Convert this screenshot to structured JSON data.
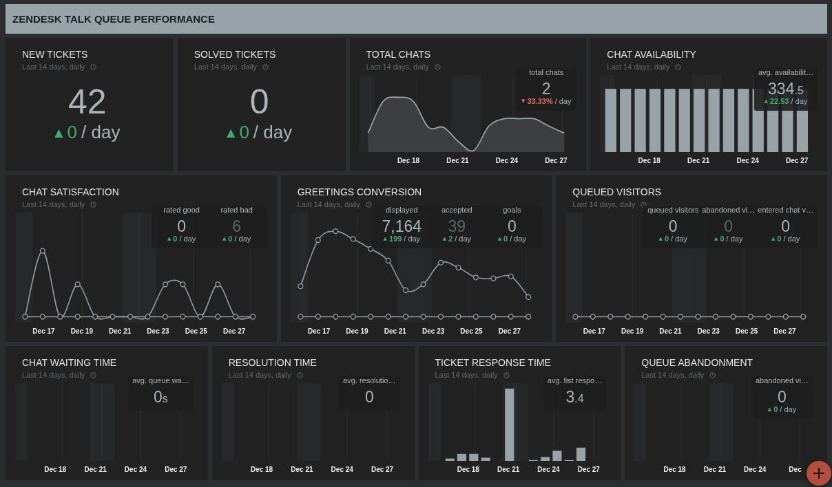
{
  "header": {
    "title": "ZENDESK TALK QUEUE PERFORMANCE"
  },
  "rows": [
    {
      "cards": [
        {
          "title": "NEW TICKETS",
          "subtitle": "Last 14 days, daily",
          "kind": "number",
          "value": "42",
          "rising": true,
          "arrow": "▲",
          "delta": "0",
          "per": "/ day"
        },
        {
          "title": "SOLVED TICKETS",
          "subtitle": "Last 14 days, daily",
          "kind": "number",
          "value": "0",
          "rising": true,
          "arrow": "▲",
          "delta": "0",
          "per": "/ day"
        },
        {
          "title": "TOTAL CHATS",
          "subtitle": "Last 14 days, daily",
          "kind": "area",
          "x_labels": [
            "Dec 18",
            "Dec 21",
            "Dec 24",
            "Dec 27"
          ],
          "stats": [
            {
              "label": "total chats",
              "value": "2",
              "muted": false,
              "rising": false,
              "arrow": "▼",
              "delta": "33.33%",
              "per": "/ day"
            }
          ]
        },
        {
          "title": "CHAT AVAILABILITY",
          "subtitle": "Last 14 days, daily",
          "kind": "bars",
          "x_labels": [
            "Dec 18",
            "Dec 21",
            "Dec 24",
            "Dec 27"
          ],
          "stats": [
            {
              "label": "avg. availabilit…",
              "value": "334",
              "suffix": ".5",
              "muted": false,
              "rising": true,
              "arrow": "▲",
              "delta": "22.53",
              "per": "/ day"
            }
          ]
        }
      ]
    },
    {
      "cards": [
        {
          "title": "CHAT SATISFACTION",
          "subtitle": "Last 14 days, daily",
          "kind": "line",
          "x_labels": [
            "Dec 17",
            "Dec 19",
            "Dec 21",
            "Dec 23",
            "Dec 25",
            "Dec 27"
          ],
          "stats": [
            {
              "label": "rated good",
              "value": "0",
              "muted": false,
              "rising": true,
              "arrow": "▲",
              "delta": "0",
              "per": "/ day"
            },
            {
              "label": "rated bad",
              "value": "6",
              "muted": true,
              "rising": true,
              "arrow": "▲",
              "delta": "0",
              "per": "/ day"
            }
          ]
        },
        {
          "title": "GREETINGS CONVERSION",
          "subtitle": "Last 14 days, daily",
          "kind": "line",
          "x_labels": [
            "Dec 17",
            "Dec 19",
            "Dec 21",
            "Dec 23",
            "Dec 25",
            "Dec 27"
          ],
          "stats": [
            {
              "label": "displayed",
              "value": "7,164",
              "muted": false,
              "rising": true,
              "arrow": "▲",
              "delta": "199",
              "per": "/ day"
            },
            {
              "label": "accepted",
              "value": "39",
              "muted": true,
              "rising": true,
              "arrow": "▲",
              "delta": "2",
              "per": "/ day"
            },
            {
              "label": "goals",
              "value": "0",
              "muted": false,
              "rising": true,
              "arrow": "▲",
              "delta": "0",
              "per": "/ day"
            }
          ]
        },
        {
          "title": "QUEUED VISITORS",
          "subtitle": "Last 14 days, daily",
          "kind": "line",
          "x_labels": [
            "Dec 17",
            "Dec 19",
            "Dec 21",
            "Dec 23",
            "Dec 25",
            "Dec 27"
          ],
          "stats": [
            {
              "label": "queued visitors",
              "value": "0",
              "muted": false,
              "rising": true,
              "arrow": "▲",
              "delta": "0",
              "per": "/ day"
            },
            {
              "label": "abandoned vi…",
              "value": "0",
              "muted": true,
              "rising": true,
              "arrow": "▲",
              "delta": "0",
              "per": "/ day"
            },
            {
              "label": "entered chat v…",
              "value": "0",
              "muted": false,
              "rising": true,
              "arrow": "▲",
              "delta": "0",
              "per": "/ day"
            }
          ]
        }
      ]
    },
    {
      "cards": [
        {
          "title": "CHAT WAITING TIME",
          "subtitle": "Last 14 days, daily",
          "kind": "empty",
          "x_labels": [
            "Dec 18",
            "Dec 21",
            "Dec 24",
            "Dec 27"
          ],
          "stats": [
            {
              "label": "avg. queue wa…",
              "value": "0",
              "suffix": "s",
              "muted": false
            }
          ]
        },
        {
          "title": "RESOLUTION TIME",
          "subtitle": "Last 14 days, daily",
          "kind": "empty",
          "x_labels": [
            "Dec 18",
            "Dec 21",
            "Dec 24",
            "Dec 27"
          ],
          "stats": [
            {
              "label": "avg. resolutio…",
              "value": "0",
              "muted": false
            }
          ]
        },
        {
          "title": "TICKET RESPONSE TIME",
          "subtitle": "Last 14 days, daily",
          "kind": "bars",
          "x_labels": [
            "Dec 18",
            "Dec 21",
            "Dec 24",
            "Dec 27"
          ],
          "stats": [
            {
              "label": "avg. fist respo…",
              "value": "3",
              "suffix": ".4",
              "muted": false
            }
          ]
        },
        {
          "title": "QUEUE ABANDONMENT",
          "subtitle": "Last 14 days, daily",
          "kind": "empty",
          "x_labels": [
            "Dec 18",
            "Dec 21",
            "Dec 24",
            "Dec"
          ],
          "stats": [
            {
              "label": "abandoned vi…",
              "value": "0",
              "muted": false,
              "rising": true,
              "arrow": "▲",
              "delta": "0",
              "per": "/ day"
            }
          ]
        }
      ]
    }
  ]
}
